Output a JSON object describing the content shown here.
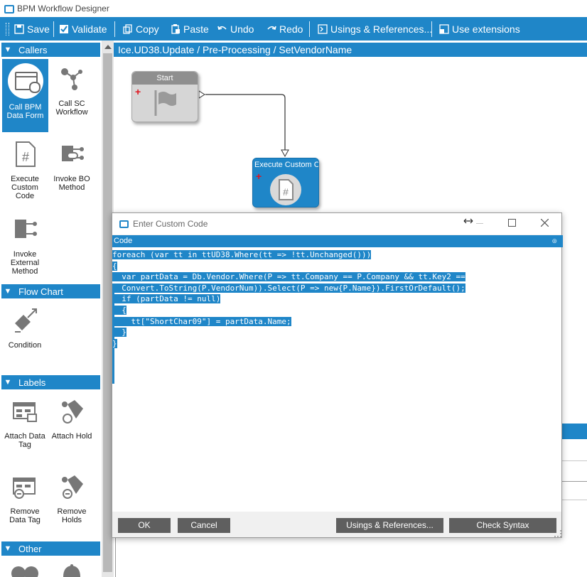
{
  "window": {
    "title": "BPM Workflow Designer"
  },
  "toolbar": {
    "save": "Save",
    "validate": "Validate",
    "copy": "Copy",
    "paste": "Paste",
    "undo": "Undo",
    "redo": "Redo",
    "usings": "Usings & References...",
    "extensions": "Use extensions"
  },
  "sidebar": {
    "callers": {
      "title": "Callers",
      "items": [
        "Call BPM Data Form",
        "Call SC Workflow",
        "Execute Custom Code",
        "Invoke BO Method",
        "Invoke External Method"
      ]
    },
    "flowchart": {
      "title": "Flow Chart",
      "items": [
        "Condition"
      ]
    },
    "labels": {
      "title": "Labels",
      "items": [
        "Attach Data Tag",
        "Attach Hold",
        "Remove Data Tag",
        "Remove Holds"
      ]
    },
    "other": {
      "title": "Other"
    }
  },
  "canvas": {
    "breadcrumb": "Ice.UD38.Update / Pre-Processing / SetVendorName",
    "start_node": "Start",
    "custom_node": "Execute Custom Co"
  },
  "dialog": {
    "title": "Enter Custom Code",
    "code_header": "Code",
    "code_lines": [
      "foreach (var tt in ttUD38.Where(tt => !tt.Unchanged()))",
      "{",
      "  var partData = Db.Vendor.Where(P => tt.Company == P.Company && tt.Key2 ==",
      "  Convert.ToString(P.VendorNum)).Select(P => new{P.Name}).FirstOrDefault();",
      "  if (partData != null)",
      "  {",
      "    tt[\"ShortChar09\"] = partData.Name;",
      "  }",
      "}"
    ],
    "buttons": {
      "ok": "OK",
      "cancel": "Cancel",
      "usings": "Usings & References...",
      "check": "Check Syntax"
    }
  },
  "colors": {
    "accent": "#1f86c8",
    "button": "#5f5f5f",
    "node_gray": "#d6d6d6"
  }
}
